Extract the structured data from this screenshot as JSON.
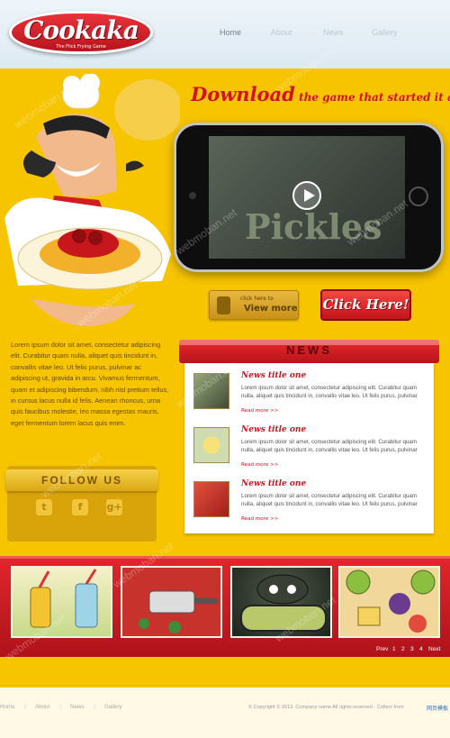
{
  "header": {
    "logo_text": "Cookaka",
    "logo_tagline": "The Flick Frying Game",
    "nav": [
      {
        "label": "Home"
      },
      {
        "label": "About"
      },
      {
        "label": "News"
      },
      {
        "label": "Gallery"
      }
    ]
  },
  "hero": {
    "download_big": "Download",
    "download_small": " the game that started it all!",
    "screen_word": "Pickles",
    "view_more_small": "click here to",
    "view_more_big": "View more",
    "click_here": "Click Here!"
  },
  "intro_text": "Lorem ipsum dolor sit amet, consectetur adipiscing elit. Curabitur quam nulla, aliquet quis tincidunt in, convallis vitae leo. Ut felis purus, pulvinar ac adipiscing ut, gravida in arcu. Vivamus fermentum, quam et adipiscing bibendum, nibh nisl pretium tellus, in cursus lacus nulla id felis. Aenean rhoncus, urna quis faucibus molestie, leo massa egestas mauris, eget fermentum lorem lacus quis enim.",
  "follow": {
    "title": "FOLLOW US",
    "icons": [
      "twitter-icon",
      "facebook-icon",
      "google-plus-icon"
    ]
  },
  "news": {
    "title": "NEWS",
    "items": [
      {
        "title": "News title one",
        "body": "Lorem ipsum dolor sit amet, consectetur adipiscing elit. Curabitur quam nulla, aliquet quis tincidunt in, convallis vitae leo. Ut felis purus, pulvinar",
        "more": "Read more >>"
      },
      {
        "title": "News title one",
        "body": "Lorem ipsum dolor sit amet, consectetur adipiscing elit. Curabitur quam nulla, aliquet quis tincidunt in, convallis vitae leo. Ut felis purus, pulvinar",
        "more": "Read more >>"
      },
      {
        "title": "News title one",
        "body": "Lorem ipsum dolor sit amet, consectetur adipiscing elit. Curabitur quam nulla, aliquet quis tincidunt in, convallis vitae leo. Ut felis purus, pulvinar",
        "more": "Read more >>"
      }
    ]
  },
  "gallery": {
    "pager": {
      "prev": "Prev",
      "pages": [
        "1",
        "2",
        "3",
        "4"
      ],
      "next": "Next"
    }
  },
  "footer": {
    "nav": [
      {
        "label": "Home"
      },
      {
        "label": "About"
      },
      {
        "label": "News"
      },
      {
        "label": "Gallery"
      }
    ],
    "separator": "|",
    "copyright": "© Copyright © 2013. Company name All rights reserved - Collect from",
    "copyright_link": "网页模板"
  },
  "watermark": "webmoban.net",
  "colors": {
    "brand_red": "#d3121f",
    "background_yellow": "#f7c400",
    "header_bg": "#eef5fa"
  }
}
